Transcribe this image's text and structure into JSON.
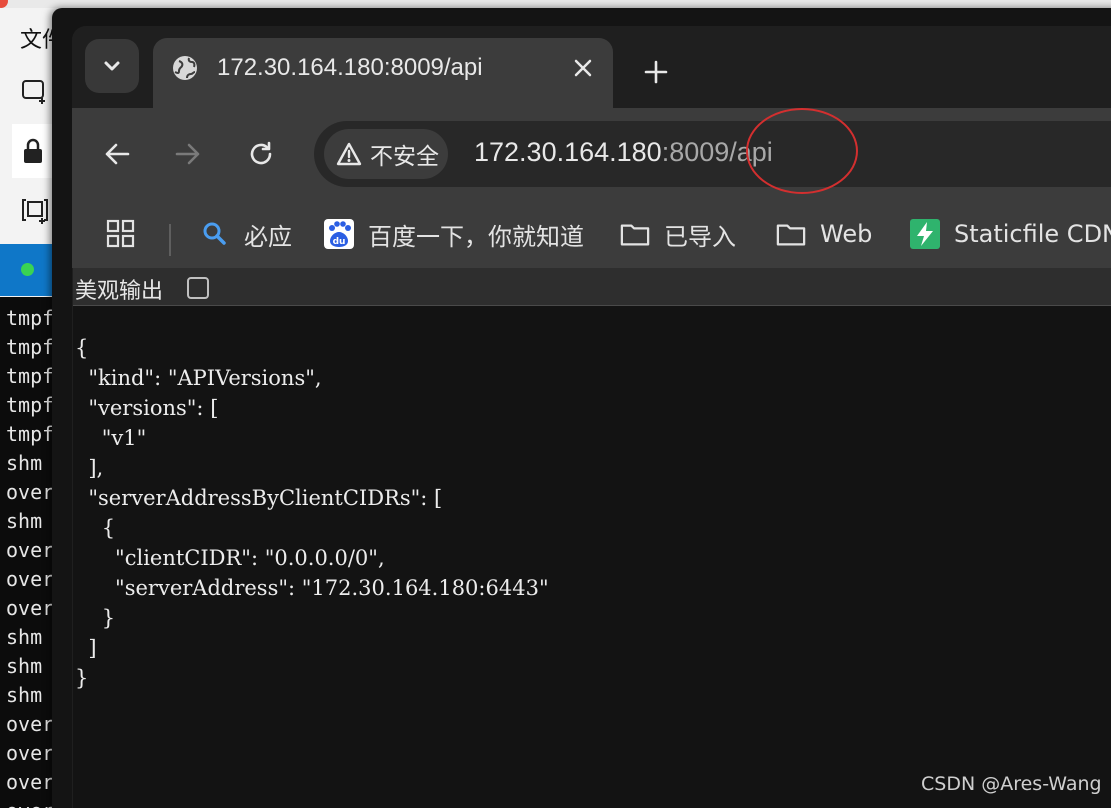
{
  "background_window": {
    "menu_text": "文件",
    "terminal_lines": [
      "tmpfs",
      "tmpfs",
      "tmpfs",
      "tmpfs",
      "tmpfs",
      "shm",
      "overlay",
      "shm",
      "overlay",
      "overlay",
      "overlay",
      "shm",
      "shm",
      "shm",
      "overlay",
      "overlay",
      "overlay",
      "overlay"
    ]
  },
  "browser": {
    "tab": {
      "title": "172.30.164.180:8009/api"
    },
    "omnibox": {
      "security_label": "不安全",
      "url_host": "172.30.164.180",
      "url_port": ":8009",
      "url_path": "/api"
    },
    "bookmarks": [
      {
        "label": "必应",
        "icon": "search-icon"
      },
      {
        "label": "百度一下，你就知道",
        "icon": "baidu-icon"
      },
      {
        "label": "已导入",
        "icon": "folder-icon"
      },
      {
        "label": "Web",
        "icon": "folder-icon"
      },
      {
        "label": "Staticfile CDN",
        "icon": "staticfile-icon"
      }
    ]
  },
  "page": {
    "pretty_print_label": "美观输出",
    "pretty_print_checked": false,
    "json_lines": [
      "{",
      "  \"kind\": \"APIVersions\",",
      "  \"versions\": [",
      "    \"v1\"",
      "  ],",
      "  \"serverAddressByClientCIDRs\": [",
      "    {",
      "      \"clientCIDR\": \"0.0.0.0/0\",",
      "      \"serverAddress\": \"172.30.164.180:6443\"",
      "    }",
      "  ]",
      "}"
    ],
    "watermark": "CSDN @Ares-Wang"
  },
  "colors": {
    "annotation": "#d32f2f",
    "tab_active": "#3c3c3c",
    "page_bg": "#131313"
  }
}
